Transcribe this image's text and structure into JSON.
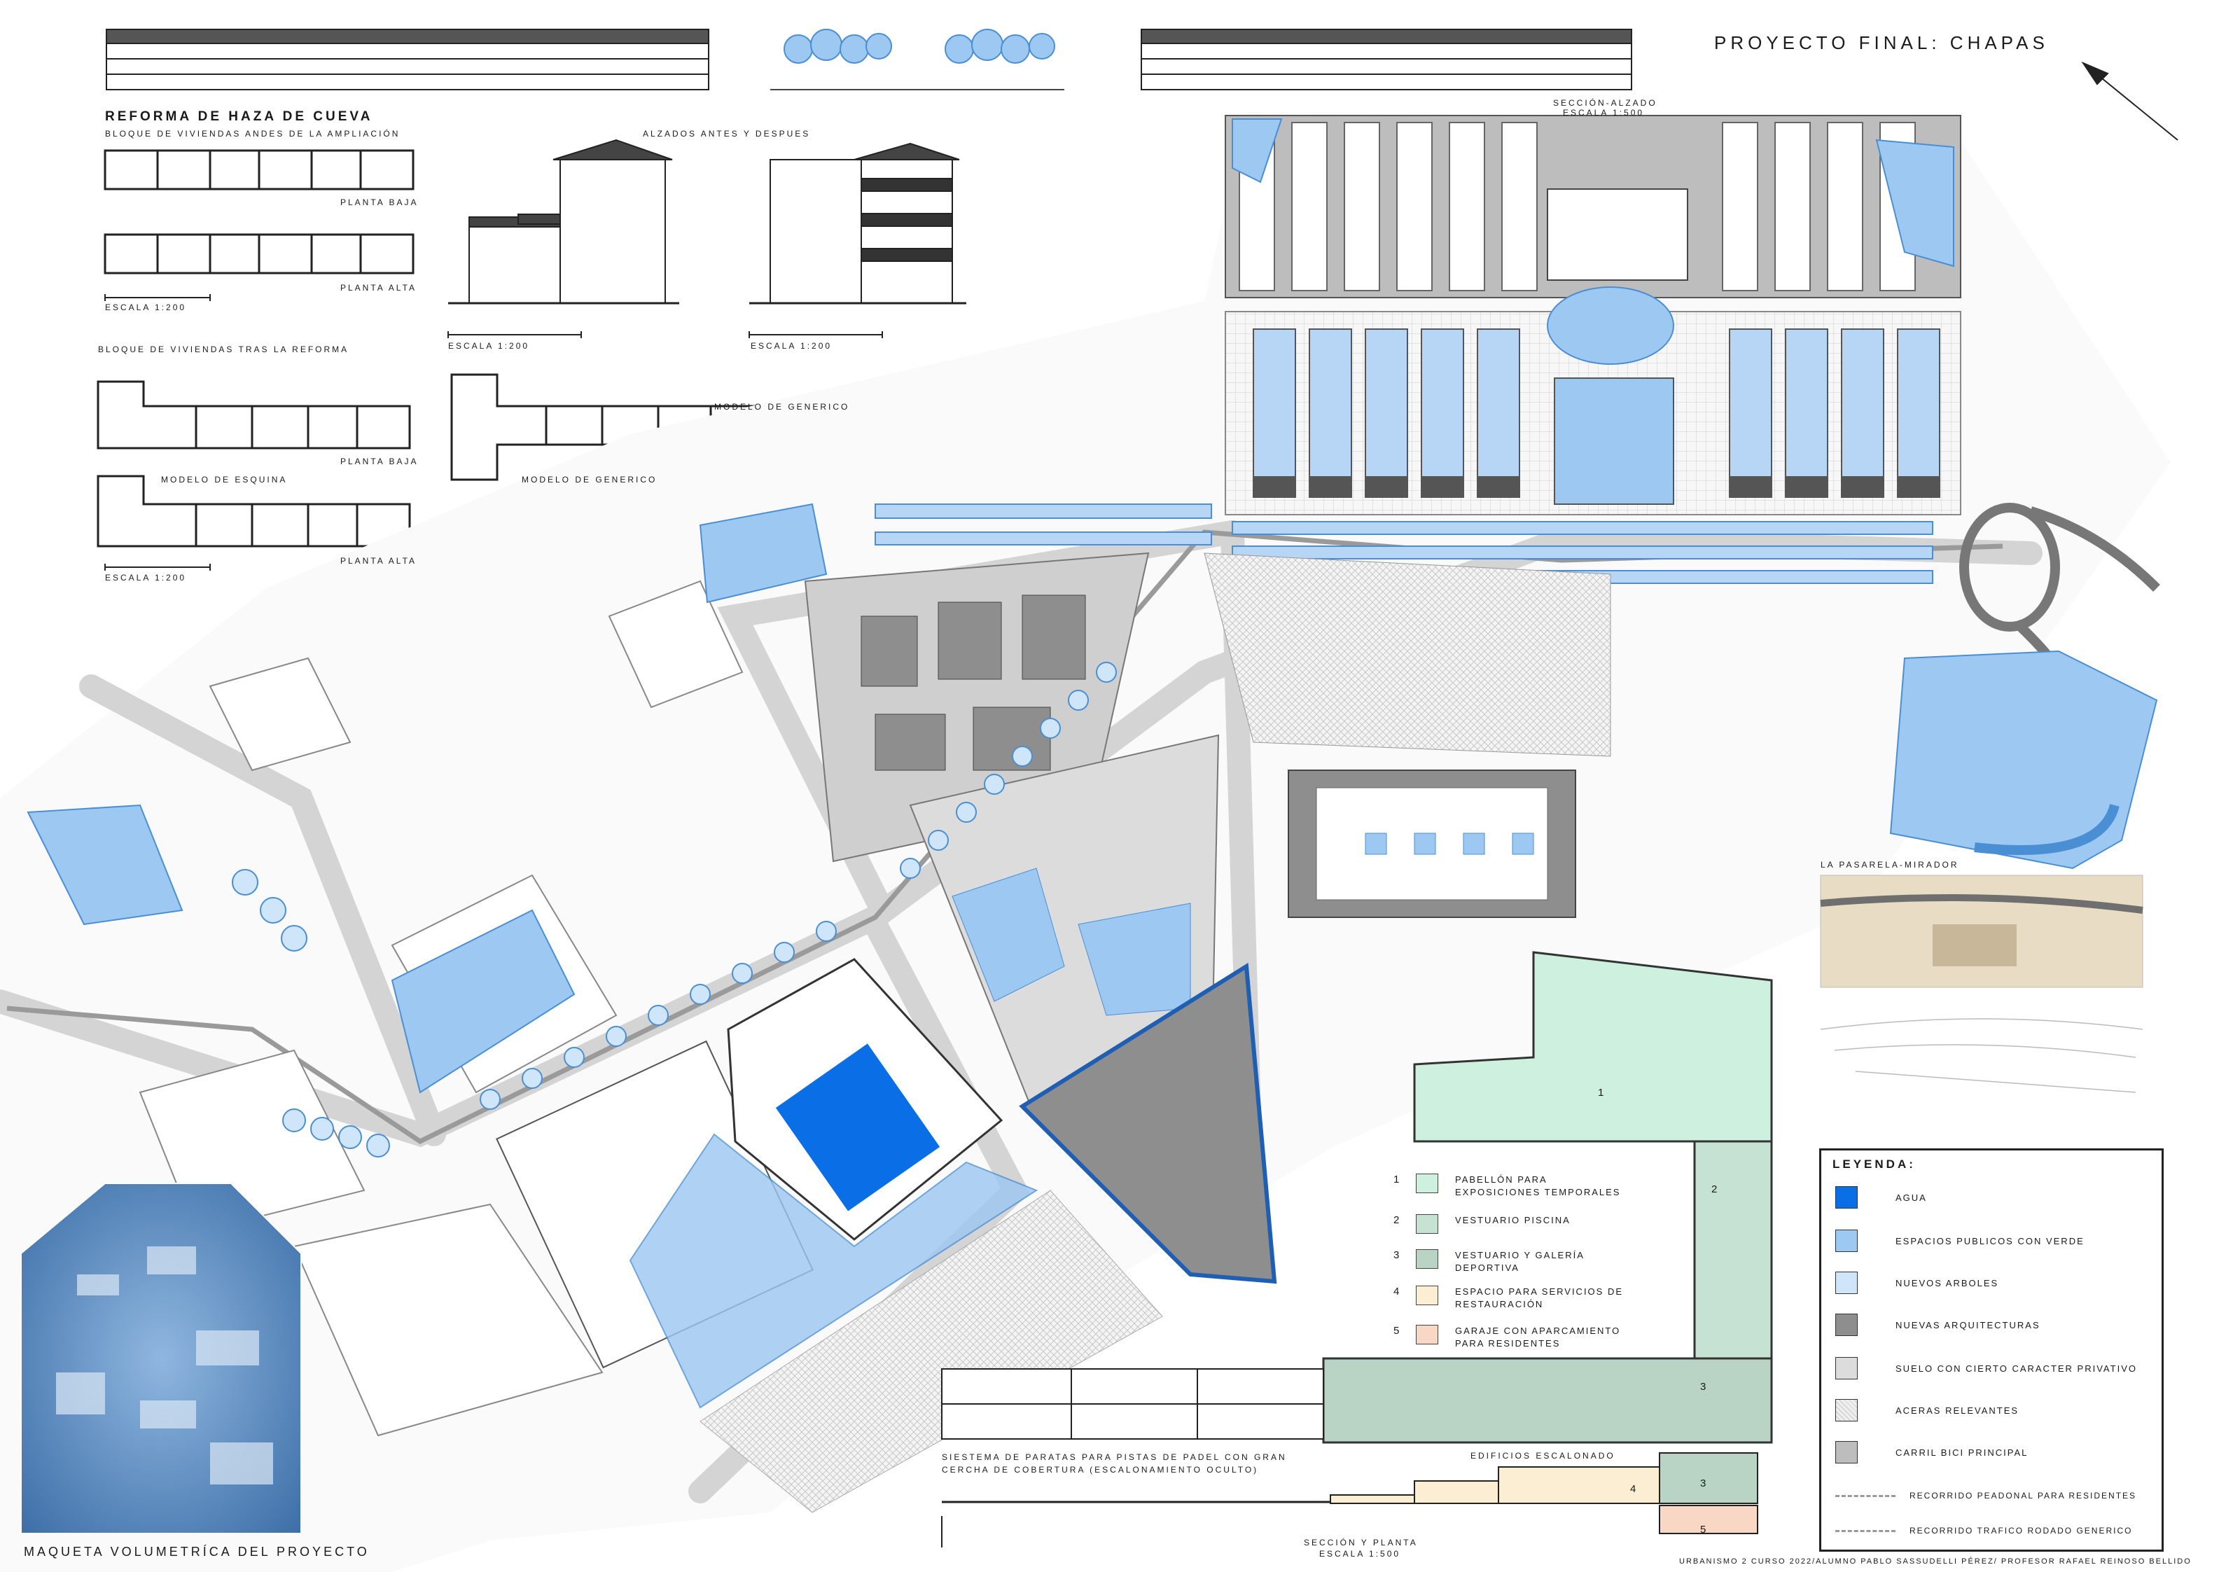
{
  "title": "PROYECTO FINAL: CHAPAS",
  "seccion_alzado": {
    "title": "SECCIÓN-ALZADO",
    "scale": "ESCALA 1:500"
  },
  "reforma": {
    "title": "REFORMA DE HAZA DE CUEVA",
    "before_title": "BLOQUE DE VIVIENDAS ANDES DE LA AMPLIACIÓN",
    "planta_baja": "PLANTA BAJA",
    "planta_alta": "PLANTA ALTA",
    "scale": "ESCALA 1:200",
    "alzados_title": "ALZADOS ANTES Y DESPUES",
    "after_title": "BLOQUE DE VIVIENDAS TRAS LA REFORMA",
    "modelo_generico": "MODELO DE GENERICO",
    "modelo_esquina": "MODELO DE ESQUINA"
  },
  "pasarela": "LA PASARELA-MIRADOR",
  "legend": {
    "title": "LEYENDA:",
    "items": [
      {
        "label": "AGUA",
        "color": "#0a6fe6",
        "kind": "fill"
      },
      {
        "label": "ESPACIOS PUBLICOS CON VERDE",
        "color": "#9cc8f2",
        "kind": "fill"
      },
      {
        "label": "NUEVOS ARBOLES",
        "color": "#cfe6fa",
        "kind": "fill"
      },
      {
        "label": "NUEVAS ARQUITECTURAS",
        "color": "#8e8e8e",
        "kind": "fill"
      },
      {
        "label": "SUELO CON CIERTO CARACTER PRIVATIVO",
        "color": "#dcdcdc",
        "kind": "fill"
      },
      {
        "label": "ACERAS RELEVANTES",
        "color": "#eeeeee",
        "kind": "hatch"
      },
      {
        "label": "CARRIL BICI PRINCIPAL",
        "color": "#bdbdbd",
        "kind": "fill"
      },
      {
        "label": "RECORRIDO PEADONAL PARA RESIDENTES",
        "color": "#999999",
        "kind": "line"
      },
      {
        "label": "RECORRIDO TRAFICO RODADO GENERICO",
        "color": "#999999",
        "kind": "line"
      }
    ]
  },
  "program": [
    {
      "n": "1",
      "label": "PABELLÓN PARA EXPOSICIONES TEMPORALES",
      "color": "#cdf0df"
    },
    {
      "n": "2",
      "label": "VESTUARIO PISCINA",
      "color": "#c6e2d2"
    },
    {
      "n": "3",
      "label": "VESTUARIO Y GALERÍA DEPORTIVA",
      "color": "#b9d4c4"
    },
    {
      "n": "4",
      "label": "ESPACIO PARA SERVICIOS DE RESTAURACIÓN",
      "color": "#fbeed2"
    },
    {
      "n": "5",
      "label": "GARAJE CON APARCAMIENTO PARA RESIDENTES",
      "color": "#f8d7c4"
    }
  ],
  "section": {
    "padel_caption": "SIESTEMA DE PARATAS PARA PISTAS DE PADEL CON GRAN CERCHA DE COBERTURA (ESCALONAMIENTO OCULTO)",
    "edificios": "EDIFICIOS ESCALONADO",
    "title": "SECCIÓN Y PLANTA",
    "scale": "ESCALA 1:500"
  },
  "maqueta": "MAQUETA VOLUMETRÍCA DEL PROYECTO",
  "credits": "URBANISMO 2 CURSO 2022/ALUMNO PABLO SASSUDELLI PÉREZ/ PROFESOR RAFAEL REINOSO BELLIDO",
  "colors": {
    "water": "#0a6fe6",
    "green": "#9cc8f2",
    "tree": "#cfe6fa",
    "building": "#8e8e8e",
    "private": "#dcdcdc",
    "white": "#ffffff"
  }
}
